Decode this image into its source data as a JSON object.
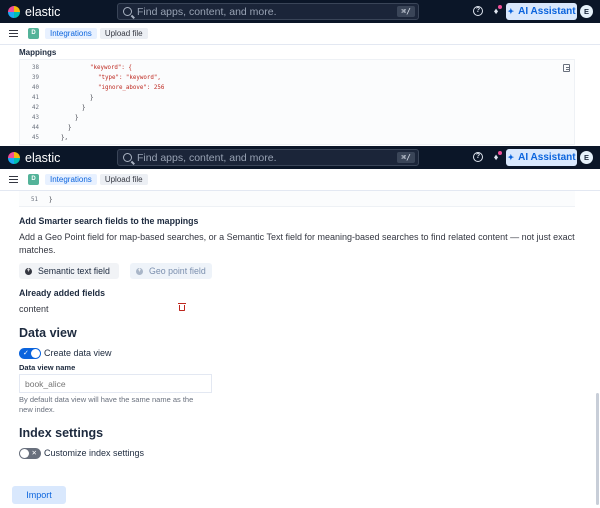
{
  "header": {
    "brand": "elastic",
    "search_placeholder": "Find apps, content, and more.",
    "search_shortcut": "⌘/",
    "help_icon": "help-icon",
    "notifications_icon": "bell-icon",
    "ai_assistant_label": "AI Assistant",
    "avatar_initial": "E"
  },
  "breadcrumbs": {
    "space_initial": "D",
    "items": [
      "Integrations",
      "Upload file"
    ]
  },
  "mappings": {
    "title": "Mappings",
    "lines": [
      {
        "n": "38",
        "text": "\"keyword\": {"
      },
      {
        "n": "39",
        "text": "\"type\": \"keyword\","
      },
      {
        "n": "40",
        "text": "\"ignore_above\": 256"
      },
      {
        "n": "41",
        "text": "}"
      },
      {
        "n": "42",
        "text": "}"
      },
      {
        "n": "43",
        "text": "}"
      },
      {
        "n": "44",
        "text": "}"
      },
      {
        "n": "45",
        "text": "},"
      }
    ],
    "last_line": {
      "n": "51",
      "text": "}"
    }
  },
  "smarter_search": {
    "heading": "Add Smarter search fields to the mappings",
    "description": "Add a Geo Point field for map-based searches, or a Semantic Text field for meaning-based searches to find related content — not just exact matches.",
    "semantic_button": "Semantic text field",
    "geo_button": "Geo point field"
  },
  "added_fields": {
    "heading": "Already added fields",
    "fields": [
      "content"
    ]
  },
  "data_view": {
    "heading": "Data view",
    "create_toggle_label": "Create data view",
    "create_enabled": true,
    "name_label": "Data view name",
    "name_placeholder": "book_alice",
    "help_text": "By default data view will have the same name as the new index."
  },
  "index_settings": {
    "heading": "Index settings",
    "customize_toggle_label": "Customize index settings",
    "customize_enabled": false
  },
  "footer": {
    "import_label": "Import"
  },
  "colors": {
    "header_bg": "#0b1628",
    "accent": "#0b64dd",
    "danger": "#bd271e",
    "space_badge": "#54b399"
  }
}
